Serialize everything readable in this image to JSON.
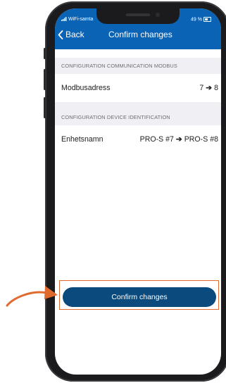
{
  "status_bar": {
    "carrier": "WiFi-samta",
    "battery": "49 %"
  },
  "nav": {
    "back_label": "Back",
    "title": "Confirm changes"
  },
  "sections": [
    {
      "header": "CONFIGURATION COMMUNICATION MODBUS",
      "rows": [
        {
          "label": "Modbusadress",
          "old": "7",
          "arrow": "➔",
          "new": "8"
        }
      ]
    },
    {
      "header": "CONFIGURATION DEVICE IDENTIFICATION",
      "rows": [
        {
          "label": "Enhetsnamn",
          "old": "PRO-S #7",
          "arrow": "➔",
          "new": "PRO-S #8"
        }
      ]
    }
  ],
  "confirm_button": {
    "label": "Confirm changes"
  },
  "colors": {
    "nav_blue": "#0a63b5",
    "button_blue": "#0b4a7d",
    "annotation_orange": "#e06a2d"
  },
  "icons": [
    "chevron-left-icon",
    "signal-icon",
    "battery-icon",
    "annotation-arrow"
  ]
}
